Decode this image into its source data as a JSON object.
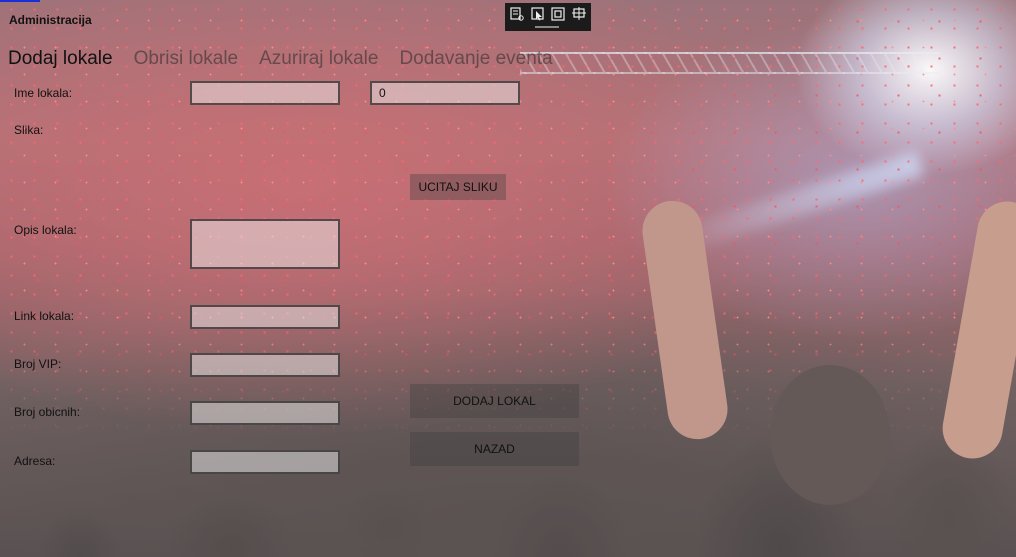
{
  "window": {
    "title": "Administracija"
  },
  "debug_toolbar": {
    "icons": [
      "live-visual-tree-icon",
      "select-element-icon",
      "display-layout-adorners-icon",
      "track-focused-element-icon"
    ]
  },
  "tabs": [
    {
      "label": "Dodaj lokale",
      "active": true
    },
    {
      "label": "Obrisi lokale",
      "active": false
    },
    {
      "label": "Azuriraj lokale",
      "active": false
    },
    {
      "label": "Dodavanje eventa",
      "active": false
    }
  ],
  "form": {
    "ime_label": "Ime lokala:",
    "ime_value": "",
    "id_value": "0",
    "slika_label": "Slika:",
    "ucitaj_slike_button": "UCITAJ SLIKU",
    "opis_label": "Opis lokala:",
    "opis_value": "",
    "link_label": "Link lokala:",
    "link_value": "",
    "vip_label": "Broj VIP:",
    "vip_value": "",
    "obicni_label": "Broj obicnih:",
    "obicni_value": "",
    "adresa_label": "Adresa:",
    "adresa_value": "",
    "dodaj_button": "DODAJ LOKAL",
    "nazad_button": "NAZAD"
  },
  "colors": {
    "accent": "#1a2fd6",
    "toolbar_bg": "#1b1b1b"
  }
}
